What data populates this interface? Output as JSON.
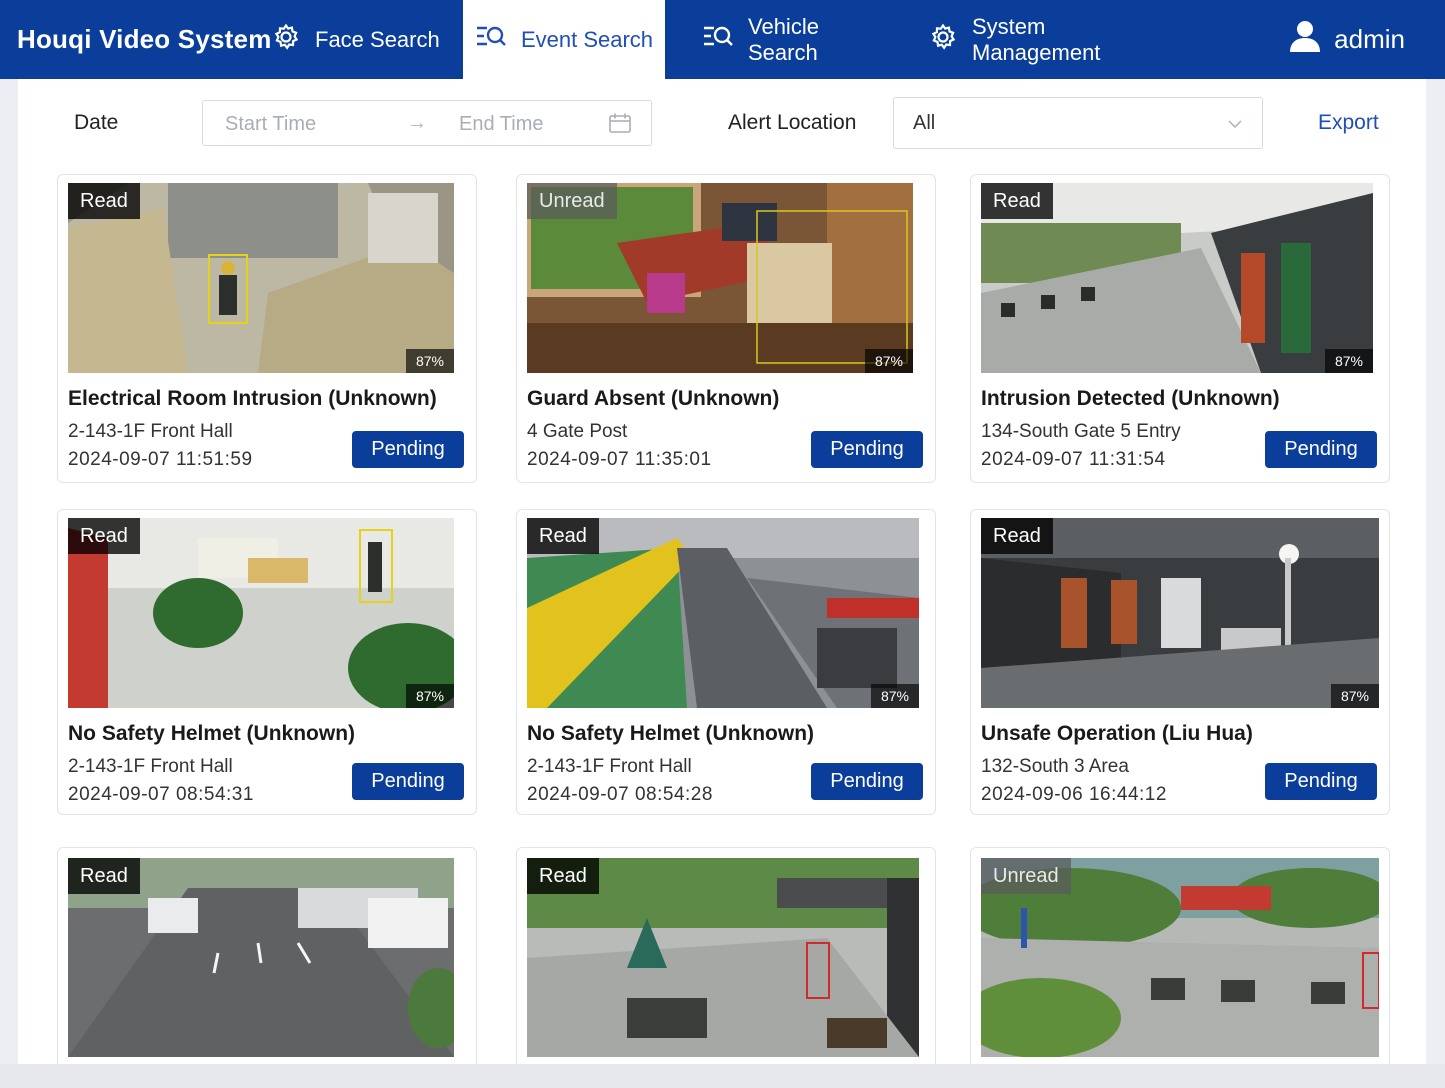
{
  "header": {
    "brand": "Houqi Video System",
    "nav": [
      {
        "label": "Face Search",
        "icon": "gear-icon"
      },
      {
        "label": "Event Search",
        "icon": "search-list-icon",
        "active": true
      },
      {
        "label": "Vehicle Search",
        "icon": "search-list-icon"
      },
      {
        "label": "System Management",
        "icon": "gear-icon"
      }
    ],
    "user": {
      "name": "admin",
      "icon": "user-icon"
    }
  },
  "filters": {
    "date_label": "Date",
    "start_placeholder": "Start Time",
    "range_separator": "→",
    "end_placeholder": "End Time",
    "location_label": "Alert Location",
    "location_value": "All",
    "export_label": "Export"
  },
  "colors": {
    "brand_blue": "#0a3e9a",
    "link_blue": "#1f4fb6"
  },
  "events": [
    {
      "status": "Read",
      "confidence": "87%",
      "title": "Electrical Room Intrusion (Unknown)",
      "location": "2-143-1F Front Hall",
      "time": "2024-09-07 11:51:59",
      "action": "Pending"
    },
    {
      "status": "Unread",
      "confidence": "87%",
      "title": "Guard Absent (Unknown)",
      "location": "4 Gate Post",
      "time": "2024-09-07 11:35:01",
      "action": "Pending"
    },
    {
      "status": "Read",
      "confidence": "87%",
      "title": "Intrusion Detected (Unknown)",
      "location": "134-South Gate 5 Entry",
      "time": "2024-09-07 11:31:54",
      "action": "Pending"
    },
    {
      "status": "Read",
      "confidence": "87%",
      "title": "No Safety Helmet (Unknown)",
      "location": "2-143-1F Front Hall",
      "time": "2024-09-07 08:54:31",
      "action": "Pending"
    },
    {
      "status": "Read",
      "confidence": "87%",
      "title": "No Safety Helmet (Unknown)",
      "location": "2-143-1F Front Hall",
      "time": "2024-09-07 08:54:28",
      "action": "Pending"
    },
    {
      "status": "Read",
      "confidence": "87%",
      "title": "Unsafe Operation (Liu Hua)",
      "location": "132-South 3 Area",
      "time": "2024-09-06 16:44:12",
      "action": "Pending"
    },
    {
      "status": "Read"
    },
    {
      "status": "Read"
    },
    {
      "status": "Unread"
    }
  ]
}
